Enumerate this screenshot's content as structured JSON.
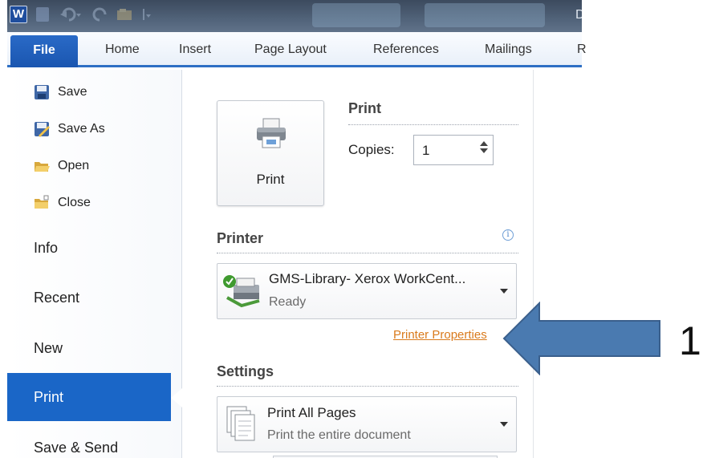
{
  "window": {
    "title_letter": "D"
  },
  "quick_access": {
    "app_logo": "W",
    "icons": [
      "word-logo-icon",
      "save-icon",
      "undo-icon",
      "redo-icon",
      "open-icon",
      "customize-icon"
    ]
  },
  "ribbon": {
    "file_tab": "File",
    "tabs": [
      "Home",
      "Insert",
      "Page Layout",
      "References",
      "Mailings",
      "R"
    ],
    "accent": "#2d6fc4"
  },
  "backstage_nav": {
    "commands": [
      {
        "label": "Save",
        "icon": "save-icon"
      },
      {
        "label": "Save As",
        "icon": "save-as-icon"
      },
      {
        "label": "Open",
        "icon": "open-folder-icon"
      },
      {
        "label": "Close",
        "icon": "close-folder-icon"
      }
    ],
    "items": [
      "Info",
      "Recent",
      "New",
      "Print",
      "Save & Send"
    ],
    "selected": "Print",
    "selected_color": "#1a66c7"
  },
  "print_pane": {
    "print_button_label": "Print",
    "print_heading": "Print",
    "copies_label": "Copies:",
    "copies_value": "1",
    "printer_heading": "Printer",
    "printer": {
      "name": "GMS-Library- Xerox WorkCent...",
      "status": "Ready"
    },
    "printer_properties_link": "Printer Properties",
    "link_color": "#d97a1c",
    "settings_heading": "Settings",
    "pages_setting": {
      "title": "Print All Pages",
      "subtitle": "Print the entire document"
    }
  },
  "annotation": {
    "number": "1",
    "arrow_color": "#4a7ab0"
  }
}
